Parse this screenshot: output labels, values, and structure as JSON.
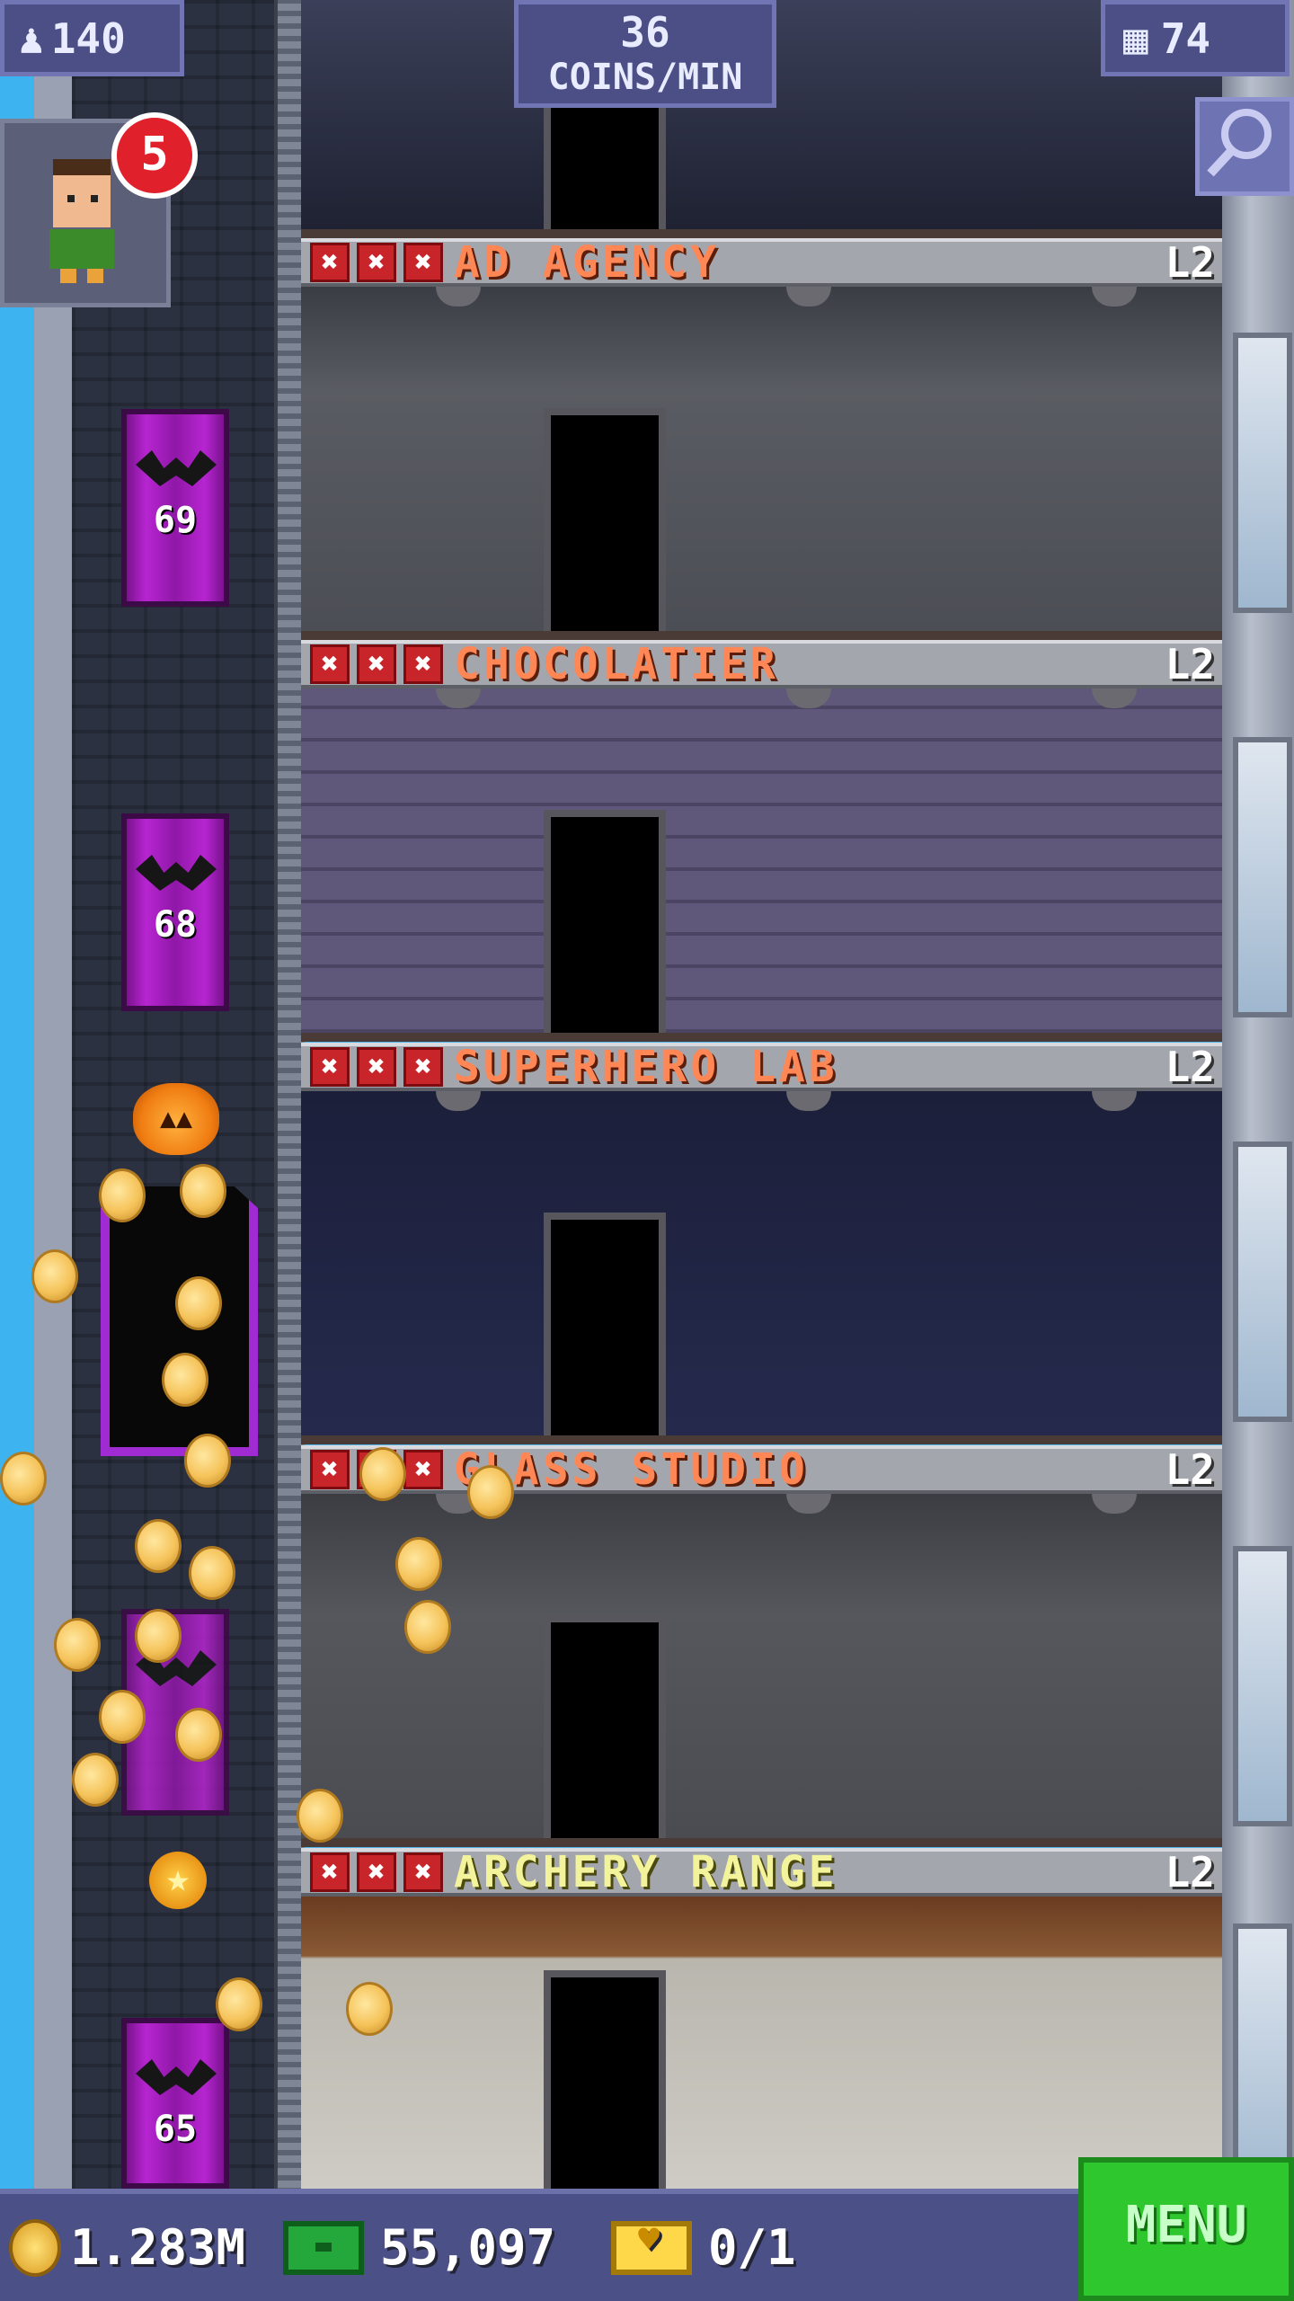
{
  "hud": {
    "population": "140",
    "coin_rate_value": "36",
    "coin_rate_unit": "COINS/MIN",
    "floor_count": "74",
    "visitor_badge": "5"
  },
  "floors": [
    {
      "name": "AD AGENCY",
      "level": "L2",
      "star_marks": [
        "✖",
        "✖",
        "✖"
      ]
    },
    {
      "name": "CHOCOLATIER",
      "level": "L2",
      "star_marks": [
        "✖",
        "✖",
        "✖"
      ]
    },
    {
      "name": "SUPERHERO LAB",
      "level": "L2",
      "star_marks": [
        "✖",
        "✖",
        "✖"
      ]
    },
    {
      "name": "GLASS STUDIO",
      "level": "L2",
      "star_marks": [
        "✖",
        "✖",
        "✖"
      ]
    },
    {
      "name": "ARCHERY RANGE",
      "level": "L2",
      "star_marks": [
        "✖",
        "✖",
        "✖"
      ]
    }
  ],
  "elevator_floors": [
    "69",
    "68",
    "65"
  ],
  "bottom_bar": {
    "coins": "1.283M",
    "bux": "55,097",
    "vip": "0/1",
    "menu_label": "MENU"
  },
  "colors": {
    "floor_name": "#ff8655",
    "elevator_panel": "#b725d1",
    "menu_button": "#2ec72e",
    "hud": "#4b4f86"
  }
}
